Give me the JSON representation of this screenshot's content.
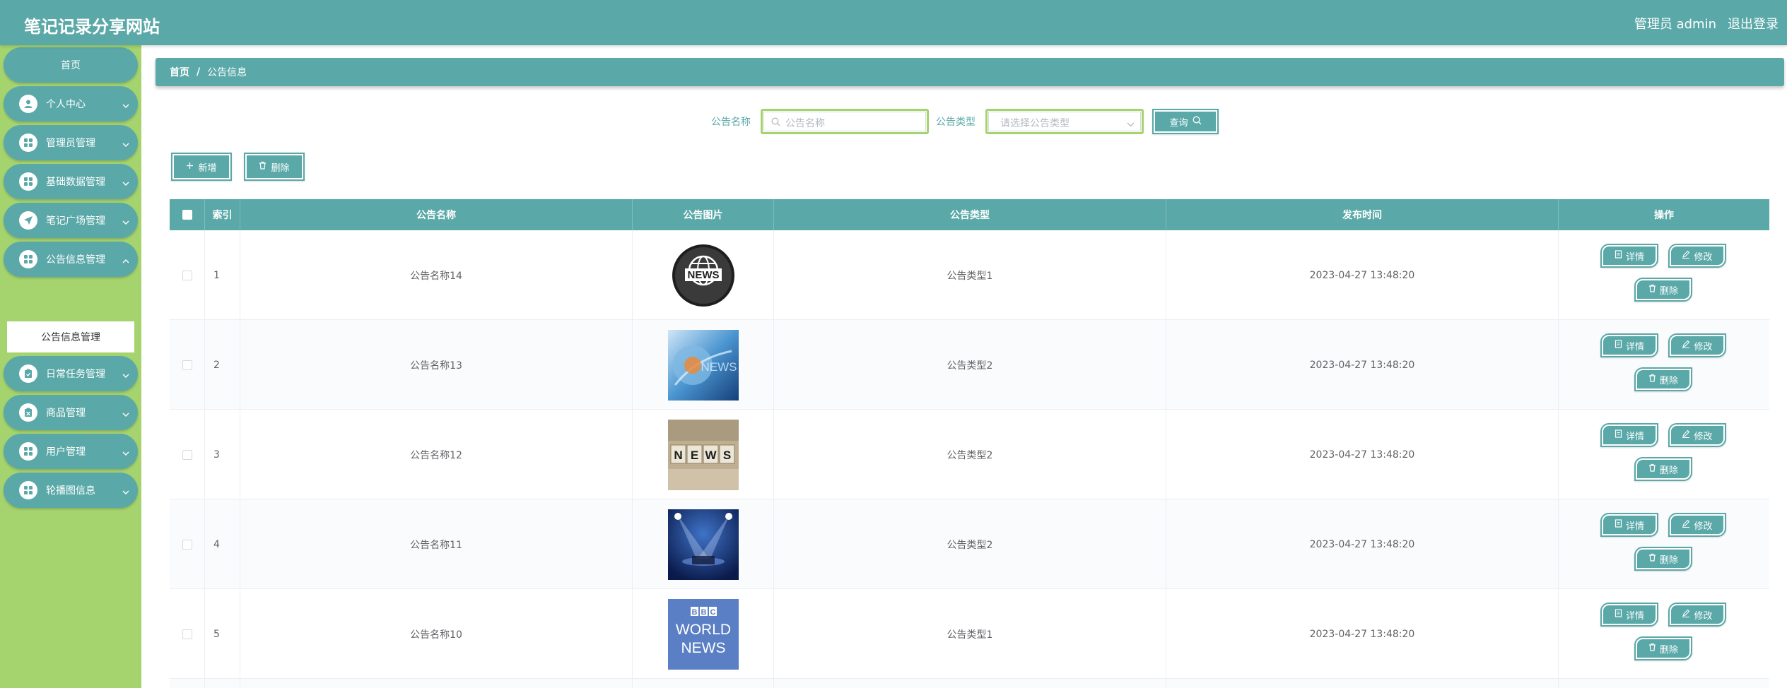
{
  "header": {
    "title": "笔记记录分享网站",
    "user": "管理员 admin",
    "logout": "退出登录"
  },
  "sidebar": {
    "home": "首页",
    "items": [
      {
        "label": "个人中心",
        "icon": "user-icon"
      },
      {
        "label": "管理员管理",
        "icon": "grid-icon"
      },
      {
        "label": "基础数据管理",
        "icon": "grid-icon"
      },
      {
        "label": "笔记广场管理",
        "icon": "send-icon"
      },
      {
        "label": "公告信息管理",
        "icon": "grid-icon"
      },
      {
        "label": "日常任务管理",
        "icon": "clipboard-icon"
      },
      {
        "label": "商品管理",
        "icon": "clipboard-icon"
      },
      {
        "label": "用户管理",
        "icon": "grid-icon"
      },
      {
        "label": "轮播图信息",
        "icon": "grid-icon"
      }
    ],
    "submenu": "公告信息管理"
  },
  "breadcrumb": {
    "home": "首页",
    "separator": "/",
    "current": "公告信息"
  },
  "search": {
    "name_label": "公告名称",
    "name_placeholder": "公告名称",
    "type_label": "公告类型",
    "type_placeholder": "请选择公告类型",
    "query_button": "查询"
  },
  "actions": {
    "add": "新增",
    "delete": "删除"
  },
  "table": {
    "headers": [
      "索引",
      "公告名称",
      "公告图片",
      "公告类型",
      "发布时间",
      "操作"
    ],
    "rows": [
      {
        "index": "1",
        "name": "公告名称14",
        "type": "公告类型1",
        "time": "2023-04-27 13:48:20",
        "image": "news-globe"
      },
      {
        "index": "2",
        "name": "公告名称13",
        "type": "公告类型2",
        "time": "2023-04-27 13:48:20",
        "image": "news-blue"
      },
      {
        "index": "3",
        "name": "公告名称12",
        "type": "公告类型2",
        "time": "2023-04-27 13:48:20",
        "image": "news-cubes"
      },
      {
        "index": "4",
        "name": "公告名称11",
        "type": "公告类型2",
        "time": "2023-04-27 13:48:20",
        "image": "news-stage"
      },
      {
        "index": "5",
        "name": "公告名称10",
        "type": "公告类型1",
        "time": "2023-04-27 13:48:20",
        "image": "bbc-world-news"
      }
    ],
    "op_labels": {
      "detail": "详情",
      "edit": "修改",
      "delete": "删除"
    }
  },
  "images": {
    "globe_text": "NEWS",
    "cubes_letters": [
      "N",
      "E",
      "W",
      "S"
    ],
    "blue_text": "NEWS",
    "bbc_letters": [
      "B",
      "B",
      "C"
    ],
    "bbc_line1": "WORLD",
    "bbc_line2": "NEWS"
  },
  "colors": {
    "primary": "#5ba8a8",
    "sidebar": "#a5d46e",
    "white": "#ffffff"
  }
}
